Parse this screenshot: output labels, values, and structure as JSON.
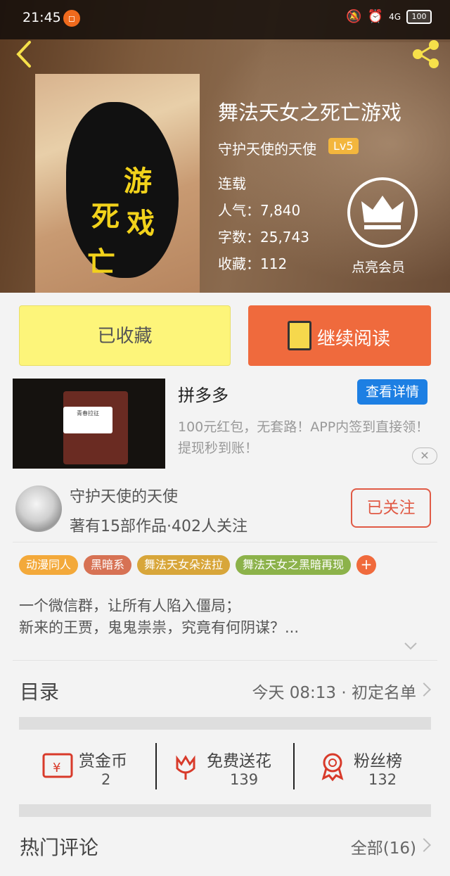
{
  "status_bar": {
    "time": "21:45",
    "battery": "100",
    "signal": "4G"
  },
  "book": {
    "title": "舞法天女之死亡游戏",
    "author": "守护天使的天使",
    "level": "Lv5",
    "status": "连载",
    "popularity": "人气：7,840",
    "word_count": "字数：25,743",
    "favorites": "收藏：112",
    "cover_chars": [
      "死",
      "亡",
      "游",
      "戏"
    ]
  },
  "vip": {
    "label": "点亮会员"
  },
  "actions": {
    "collected_label": "已收藏",
    "read_label": "继续阅读"
  },
  "ad": {
    "title": "拼多多",
    "detail_label": "查看详情",
    "description": "100元红包，无套路！APP内签到直接领！提现秒到账！",
    "close_glyph": "✕",
    "thumb_dialog_title": "青春拉征"
  },
  "author_card": {
    "name": "守护天使的天使",
    "stats": "著有15部作品·402人关注",
    "follow_label": "已关注"
  },
  "tags": [
    {
      "label": "动漫同人",
      "color": "#f3a93a"
    },
    {
      "label": "黑暗系",
      "color": "#d77254"
    },
    {
      "label": "舞法天女朵法拉",
      "color": "#d8a63a"
    },
    {
      "label": "舞法天女之黑暗再现",
      "color": "#8cb24a"
    }
  ],
  "synopsis": {
    "line1": "一个微信群，让所有人陷入僵局；",
    "line2": "新来的王贾，鬼鬼祟祟，究竟有何阴谋？..."
  },
  "toc": {
    "title": "目录",
    "latest": "今天 08:13 · 初定名单"
  },
  "stats": {
    "reward": {
      "label": "赏金币",
      "value": "2"
    },
    "flowers": {
      "label": "免费送花",
      "value": "139"
    },
    "fans": {
      "label": "粉丝榜",
      "value": "132"
    }
  },
  "comments": {
    "title": "热门评论",
    "all_label": "全部(16)"
  },
  "colors": {
    "accent": "#ef6a3d",
    "collected_bg": "#fdf57a",
    "link_blue": "#1d7fe3",
    "icon_red": "#d83a2a"
  }
}
